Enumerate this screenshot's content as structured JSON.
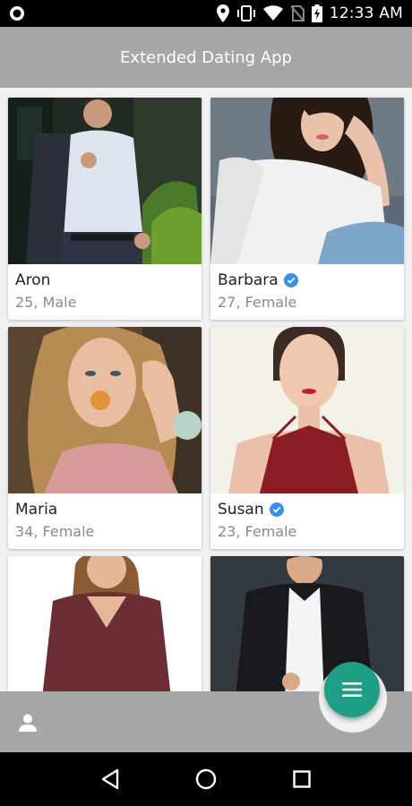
{
  "status_bar": {
    "time": "12:33 AM",
    "icons": [
      "location-icon",
      "vibrate-icon",
      "wifi-icon",
      "no-sim-icon",
      "battery-charging-icon"
    ]
  },
  "app_bar": {
    "title": "Extended Dating App"
  },
  "profiles": [
    {
      "name": "Aron",
      "details": "25, Male",
      "verified": false
    },
    {
      "name": "Barbara",
      "details": "27, Female",
      "verified": true
    },
    {
      "name": "Maria",
      "details": "34, Female",
      "verified": false
    },
    {
      "name": "Susan",
      "details": "23, Female",
      "verified": true
    },
    {
      "name": "",
      "details": "",
      "verified": false
    },
    {
      "name": "",
      "details": "",
      "verified": false
    }
  ],
  "bottom_bar": {
    "left_icon": "person-icon",
    "fab_icon": "menu-icon",
    "fab_color": "#1e9e86"
  },
  "nav_bar": {
    "icons": [
      "back-icon",
      "home-icon",
      "recents-icon"
    ]
  }
}
